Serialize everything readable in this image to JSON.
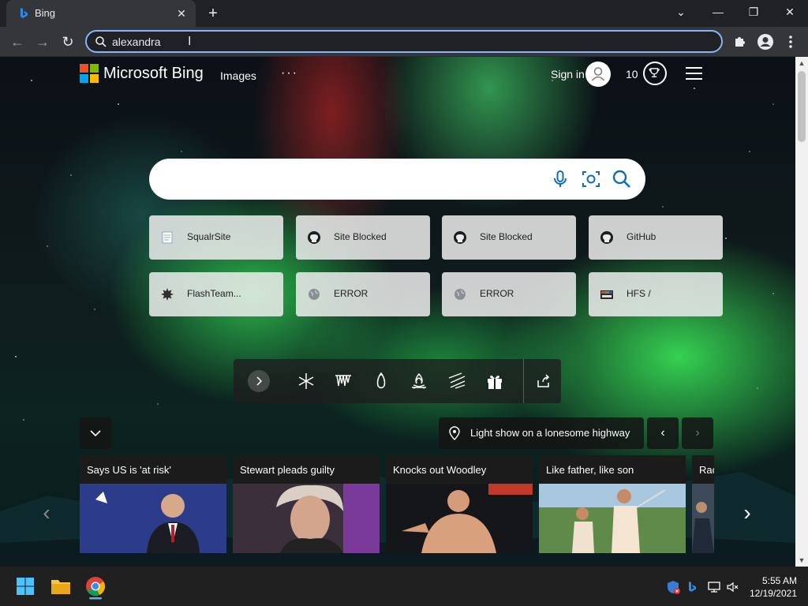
{
  "browser": {
    "tab_title": "Bing",
    "address_value": "alexandra"
  },
  "bing": {
    "brand": "Microsoft Bing",
    "nav_images": "Images",
    "nav_more": "···",
    "signin": "Sign in",
    "points": "10"
  },
  "tiles": [
    {
      "label": "SqualrSite",
      "icon": "page-icon"
    },
    {
      "label": "Site Blocked",
      "icon": "github-icon"
    },
    {
      "label": "Site Blocked",
      "icon": "github-icon"
    },
    {
      "label": "GitHub",
      "icon": "github-icon"
    },
    {
      "label": "FlashTeam...",
      "icon": "gear-badge-icon"
    },
    {
      "label": "ERROR",
      "icon": "globe-icon"
    },
    {
      "label": "ERROR",
      "icon": "globe-icon"
    },
    {
      "label": "HFS /",
      "icon": "hfs-icon"
    }
  ],
  "caption": "Light show on a lonesome highway",
  "news": [
    {
      "title": "Says US is 'at risk'"
    },
    {
      "title": "Stewart pleads guilty"
    },
    {
      "title": "Knocks out Woodley"
    },
    {
      "title": "Like father, like son"
    },
    {
      "title": "Rac"
    }
  ],
  "taskbar": {
    "time": "5:55 AM",
    "date": "12/19/2021"
  }
}
